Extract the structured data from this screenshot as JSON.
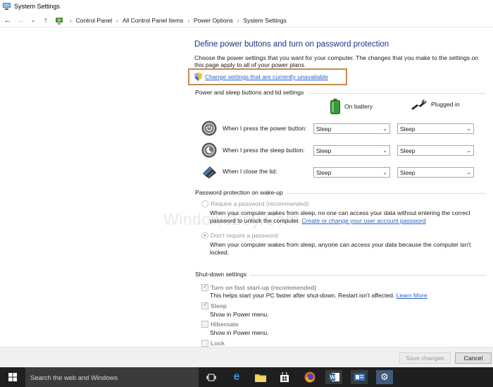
{
  "window": {
    "title": "System Settings"
  },
  "breadcrumb": [
    "Control Panel",
    "All Control Panel Items",
    "Power Options",
    "System Settings"
  ],
  "heading": "Define power buttons and turn on password protection",
  "intro": "Choose the power settings that you want for your computer. The changes that you make to the settings on this page apply to all of your power plans.",
  "change_link": "Change settings that are currently unavailable",
  "power_section": {
    "title": "Power and sleep buttons and lid settings",
    "col_battery": "On battery",
    "col_plugged": "Plugged in",
    "rows": [
      {
        "label": "When I press the power button:",
        "battery": "Sleep",
        "plugged": "Sleep"
      },
      {
        "label": "When I press the sleep button:",
        "battery": "Sleep",
        "plugged": "Sleep"
      },
      {
        "label": "When I close the lid:",
        "battery": "Sleep",
        "plugged": "Sleep"
      }
    ]
  },
  "password_section": {
    "title": "Password protection on wake-up",
    "opt1_label": "Require a password (recommended)",
    "opt1_desc": "When your computer wakes from sleep, no one can access your data without entering the correct password to unlock the computer.",
    "opt1_link": "Create or change your user account password",
    "opt2_label": "Don't require a password",
    "opt2_desc": "When your computer wakes from sleep, anyone can access your data because the computer isn't locked."
  },
  "shutdown_section": {
    "title": "Shut-down settings",
    "fast_label": "Turn on fast start-up (recommended)",
    "fast_desc": "This helps start your PC faster after shut-down. Restart isn't affected.",
    "learn_more": "Learn More",
    "sleep_label": "Sleep",
    "sleep_desc": "Show in Power menu.",
    "hibernate_label": "Hibernate",
    "hibernate_desc": "Show in Power menu.",
    "lock_label": "Lock"
  },
  "watermark": "WindowsBoy.Com",
  "buttons": {
    "save": "Save changes",
    "cancel": "Cancel"
  },
  "taskbar": {
    "search_placeholder": "Search the web and Windows"
  },
  "colors": {
    "heading": "#1e3287",
    "link": "#2a63c8",
    "highlight_box": "#c48a4f",
    "taskbar": "#1f1f1f"
  }
}
